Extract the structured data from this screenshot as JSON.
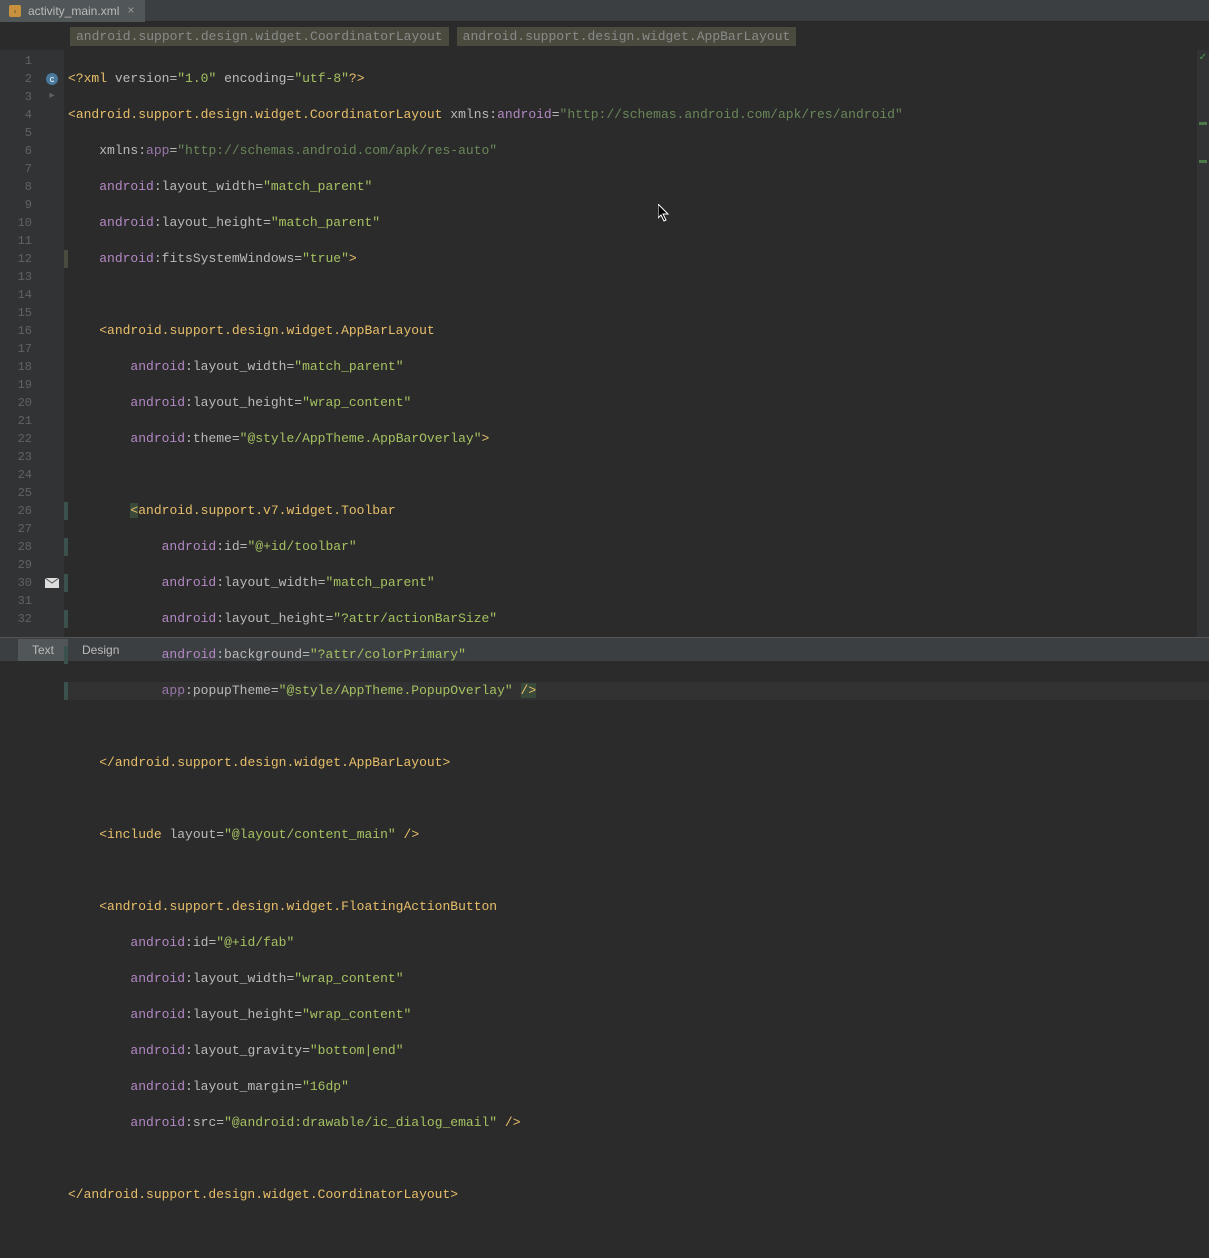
{
  "tab": {
    "name": "activity_main.xml"
  },
  "breadcrumb": {
    "item1": "android.support.design.widget.CoordinatorLayout",
    "item2": "android.support.design.widget.AppBarLayout"
  },
  "gutter": {
    "lines": [
      "1",
      "2",
      "3",
      "4",
      "5",
      "6",
      "7",
      "8",
      "9",
      "10",
      "11",
      "12",
      "13",
      "14",
      "15",
      "16",
      "17",
      "18",
      "19",
      "20",
      "21",
      "22",
      "23",
      "24",
      "25",
      "26",
      "27",
      "28",
      "29",
      "30",
      "31",
      "32"
    ]
  },
  "code": {
    "l1_xml": "xml",
    "l1_version": "version",
    "l1_version_val": "\"1.0\"",
    "l1_encoding": "encoding",
    "l1_encoding_val": "\"utf-8\"",
    "l2_tag": "android.support.design.widget.CoordinatorLayout",
    "l2_xmlns": "xmlns:",
    "l2_android": "android",
    "l2_ns_val": "\"http://schemas.android.com/apk/res/android\"",
    "l3_xmlns": "xmlns:",
    "l3_app": "app",
    "l3_ns_val": "\"http://schemas.android.com/apk/res-auto\"",
    "l4_ns": "android",
    "l4_attr": "layout_width",
    "l4_val": "\"match_parent\"",
    "l5_ns": "android",
    "l5_attr": "layout_height",
    "l5_val": "\"match_parent\"",
    "l6_ns": "android",
    "l6_attr": "fitsSystemWindows",
    "l6_val": "\"true\"",
    "l8_tag": "android.support.design.widget.AppBarLayout",
    "l9_ns": "android",
    "l9_attr": "layout_width",
    "l9_val": "\"match_parent\"",
    "l10_ns": "android",
    "l10_attr": "layout_height",
    "l10_val": "\"wrap_content\"",
    "l11_ns": "android",
    "l11_attr": "theme",
    "l11_val": "\"@style/AppTheme.AppBarOverlay\"",
    "l13_tag": "android.support.v7.widget.Toolbar",
    "l14_ns": "android",
    "l14_attr": "id",
    "l14_val": "\"@+id/toolbar\"",
    "l15_ns": "android",
    "l15_attr": "layout_width",
    "l15_val": "\"match_parent\"",
    "l16_ns": "android",
    "l16_attr": "layout_height",
    "l16_val": "\"?attr/actionBarSize\"",
    "l17_ns": "android",
    "l17_attr": "background",
    "l17_val": "\"?attr/colorPrimary\"",
    "l18_ns": "app",
    "l18_attr": "popupTheme",
    "l18_val": "\"@style/AppTheme.PopupOverlay\"",
    "l20_tag": "android.support.design.widget.AppBarLayout",
    "l22_tag": "include",
    "l22_attr": "layout",
    "l22_val": "\"@layout/content_main\"",
    "l24_tag": "android.support.design.widget.FloatingActionButton",
    "l25_ns": "android",
    "l25_attr": "id",
    "l25_val": "\"@+id/fab\"",
    "l26_ns": "android",
    "l26_attr": "layout_width",
    "l26_val": "\"wrap_content\"",
    "l27_ns": "android",
    "l27_attr": "layout_height",
    "l27_val": "\"wrap_content\"",
    "l28_ns": "android",
    "l28_attr": "layout_gravity",
    "l28_val": "\"bottom|end\"",
    "l29_ns": "android",
    "l29_attr": "layout_margin",
    "l29_val": "\"16dp\"",
    "l30_ns": "android",
    "l30_attr": "src",
    "l30_val": "\"@android:drawable/ic_dialog_email\"",
    "l32_tag": "android.support.design.widget.CoordinatorLayout"
  },
  "bottom": {
    "text": "Text",
    "design": "Design"
  }
}
